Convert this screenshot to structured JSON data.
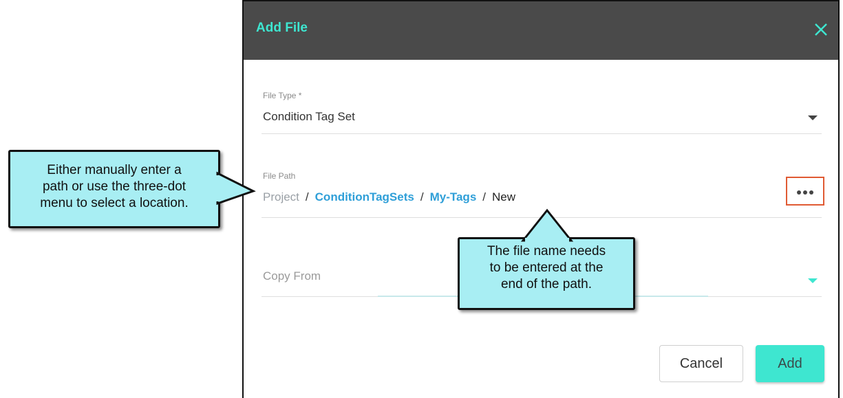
{
  "dialog": {
    "title": "Add File",
    "file_type": {
      "label": "File Type *",
      "value": "Condition Tag Set"
    },
    "file_path": {
      "label": "File Path",
      "segments": [
        "Project",
        "ConditionTagSets",
        "My-Tags",
        "New"
      ],
      "separator": "/"
    },
    "copy_from": {
      "label": "Copy From"
    },
    "buttons": {
      "cancel": "Cancel",
      "add": "Add"
    }
  },
  "callouts": {
    "left": [
      "Either manually enter a",
      "path or use the three-dot",
      "menu to select a location."
    ],
    "bottom": [
      "The file name needs",
      "to be entered at the",
      "end of the path."
    ]
  },
  "colors": {
    "accent": "#3ee6d0",
    "titlebar": "#4a4a4a",
    "link": "#2f9fd8",
    "highlight_box": "#e05a33",
    "callout_fill": "#a8eef3"
  },
  "icons": [
    "close-icon",
    "chevron-down-icon",
    "more-horizontal-icon"
  ]
}
